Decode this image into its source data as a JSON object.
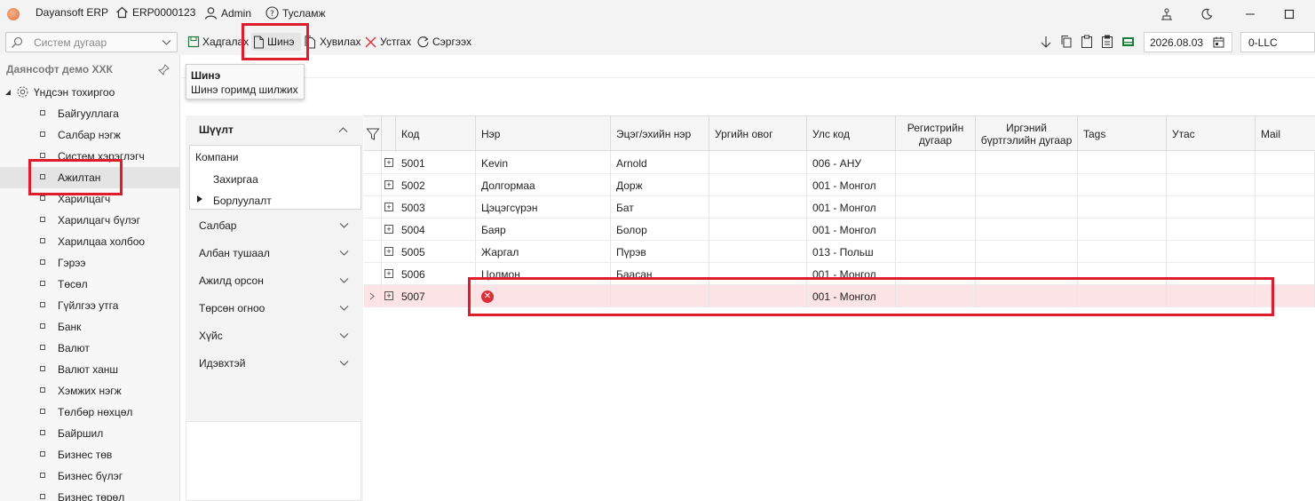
{
  "titlebar": {
    "app_name": "Dayansoft ERP",
    "instance": "ERP0000123",
    "user": "Admin",
    "help": "Тусламж"
  },
  "toolbar": {
    "search_placeholder": "Систем дугаар",
    "save_label": "Хадгалах",
    "new_label": "Шинэ",
    "copy_label": "Хувилах",
    "delete_label": "Устгах",
    "refresh_label": "Сэргээх",
    "date": "2026.08.03",
    "company": "0-LLC"
  },
  "tooltip": {
    "title": "Шинэ",
    "description": "Шинэ горимд шилжих"
  },
  "sidebar": {
    "title": "Даянсофт демо ХХК",
    "root_label": "Үндсэн тохиргоо",
    "items": [
      {
        "label": "Байгууллага"
      },
      {
        "label": "Салбар нэгж"
      },
      {
        "label": "Систем хэрэглэгч"
      },
      {
        "label": "Ажилтан",
        "selected": true
      },
      {
        "label": "Харилцагч"
      },
      {
        "label": "Харилцагч бүлэг"
      },
      {
        "label": "Харилцаа холбоо"
      },
      {
        "label": "Гэрээ"
      },
      {
        "label": "Төсөл"
      },
      {
        "label": "Гүйлгээ утга"
      },
      {
        "label": "Банк"
      },
      {
        "label": "Валют"
      },
      {
        "label": "Валют ханш"
      },
      {
        "label": "Хэмжих нэгж"
      },
      {
        "label": "Төлбөр нөхцөл"
      },
      {
        "label": "Байршил"
      },
      {
        "label": "Бизнес төв"
      },
      {
        "label": "Бизнес бүлэг"
      },
      {
        "label": "Бизнес төрөл"
      }
    ]
  },
  "filter": {
    "title": "Шүүлт",
    "tree": {
      "company": "Компани",
      "child1": "Захиргаа",
      "child2": "Борлуулалт"
    },
    "sections": [
      "Салбар",
      "Албан тушаал",
      "Ажилд орсон",
      "Төрсөн огноо",
      "Хүйс",
      "Идэвхтэй"
    ]
  },
  "grid": {
    "columns": {
      "code": "Код",
      "name": "Нэр",
      "parent_name": "Эцэг/эхийн нэр",
      "family_name": "Ургийн овог",
      "country": "Улс код",
      "register_1": "Регистрийн",
      "register_2": "дугаар",
      "citizen_1": "Иргэний",
      "citizen_2": "бүртгэлийн дугаар",
      "tags": "Tags",
      "phone": "Утас",
      "mail": "Mail"
    },
    "rows": [
      {
        "code": "5001",
        "name": "Kevin",
        "parent": "Arnold",
        "family": "",
        "country": "006 - АНУ"
      },
      {
        "code": "5002",
        "name": "Долгормаа",
        "parent": "Дорж",
        "family": "",
        "country": "001 - Монгол"
      },
      {
        "code": "5003",
        "name": "Цэцэгсүрэн",
        "parent": "Бат",
        "family": "",
        "country": "001 - Монгол"
      },
      {
        "code": "5004",
        "name": "Баяр",
        "parent": "Болор",
        "family": "",
        "country": "001 - Монгол"
      },
      {
        "code": "5005",
        "name": "Жаргал",
        "parent": "Пүрэв",
        "family": "",
        "country": "013 - Польш"
      },
      {
        "code": "5006",
        "name": "Цолмон",
        "parent": "Баасан",
        "family": "",
        "country": "001 - Монгол"
      },
      {
        "code": "5007",
        "name": "",
        "parent": "",
        "family": "",
        "country": "001 - Монгол",
        "error": true
      }
    ]
  },
  "colors": {
    "highlight": "#e01b2b",
    "error_row": "#fce4e6",
    "error_icon": "#d9303a"
  }
}
